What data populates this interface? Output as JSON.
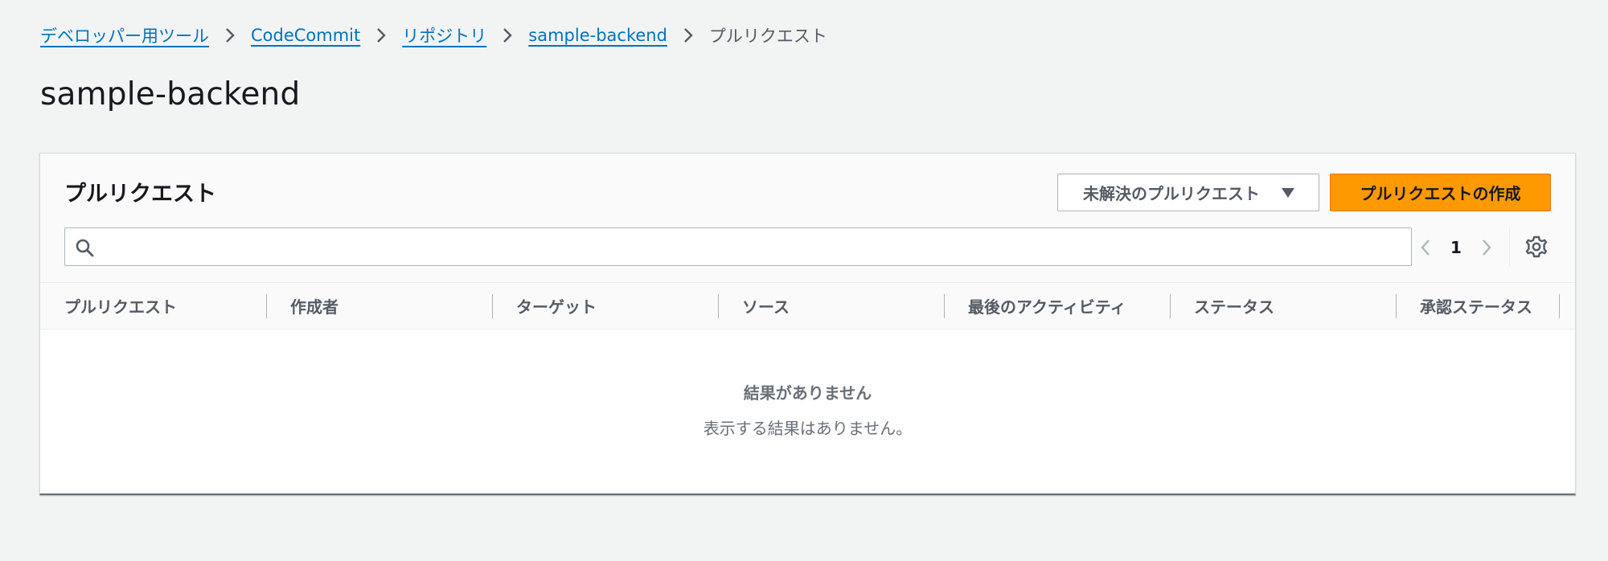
{
  "breadcrumb": {
    "items": [
      "デベロッパー用ツール",
      "CodeCommit",
      "リポジトリ",
      "sample-backend"
    ],
    "current": "プルリクエスト"
  },
  "page": {
    "title": "sample-backend"
  },
  "panel": {
    "title": "プルリクエスト",
    "filter": {
      "selected": "未解決のプルリクエスト"
    },
    "create_button": "プルリクエストの作成",
    "search": {
      "value": "",
      "placeholder": ""
    },
    "pagination": {
      "current_page": "1"
    },
    "columns": [
      "プルリクエスト",
      "作成者",
      "ターゲット",
      "ソース",
      "最後のアクティビティ",
      "ステータス",
      "承認ステータス"
    ],
    "empty_state": {
      "title": "結果がありません",
      "description": "表示する結果はありません。"
    }
  },
  "colors": {
    "link": "#0073bb",
    "primary_button": "#ff9900",
    "background": "#f2f3f3",
    "muted_text": "#687078"
  },
  "icons": [
    "chevron-right-icon",
    "caret-down-icon",
    "search-icon",
    "chevron-left-icon",
    "gear-icon"
  ]
}
